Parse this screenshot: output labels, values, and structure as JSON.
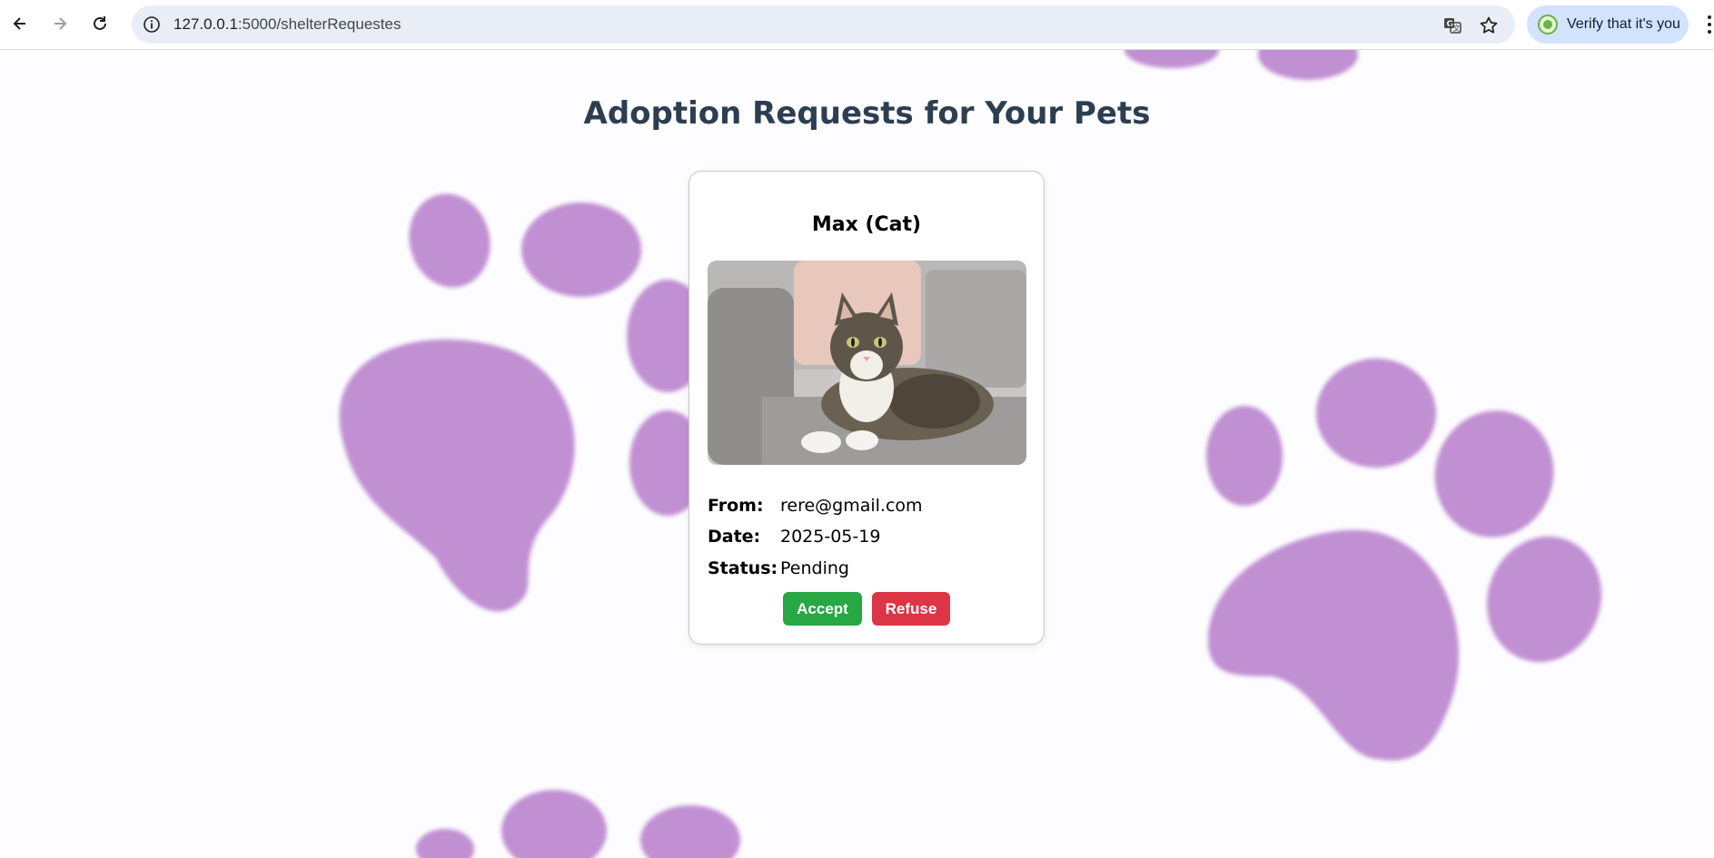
{
  "browser": {
    "url_host": "127.0.0.1",
    "url_path": ":5000/shelterRequestes",
    "verify_label": "Verify that it's you",
    "icons": {
      "back": "back-arrow-icon",
      "forward": "forward-arrow-icon",
      "reload": "reload-icon",
      "site_info": "info-icon",
      "translate": "translate-icon",
      "bookmark": "star-icon",
      "menu": "kebab-menu-icon"
    }
  },
  "page": {
    "title": "Adoption Requests for Your Pets",
    "background_accent": "#b77fcc"
  },
  "requests": [
    {
      "pet_name": "Max (Cat)",
      "photo": "cat-photo",
      "from_label": "From:",
      "from_value": "rere@gmail.com",
      "date_label": "Date:",
      "date_value": "2025-05-19",
      "status_label": "Status:",
      "status_value": "Pending",
      "accept_label": "Accept",
      "refuse_label": "Refuse",
      "accept_color": "#28a745",
      "refuse_color": "#dc3545"
    }
  ]
}
